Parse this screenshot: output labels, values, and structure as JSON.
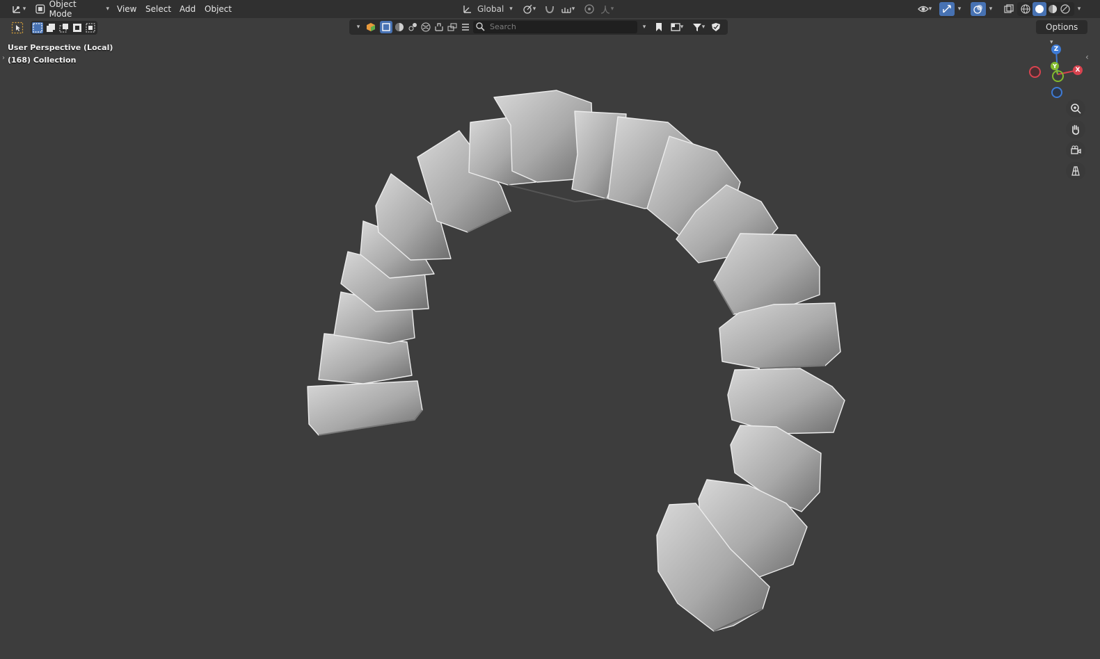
{
  "header": {
    "mode": "Object Mode",
    "menus": [
      "View",
      "Select",
      "Add",
      "Object"
    ],
    "transform_orientation": "Global"
  },
  "toolbar": {
    "search_placeholder": "Search",
    "options_label": "Options"
  },
  "viewport": {
    "perspective_label": "User Perspective (Local)",
    "collection_label": "(168) Collection"
  },
  "gizmo": {
    "z_label": "Z",
    "y_label": "Y",
    "x_label": "X",
    "x_color": "#d8434f",
    "y_color": "#82b92e",
    "z_color": "#3e7bd6"
  },
  "colors": {
    "accent": "#4772b3",
    "background": "#3d3d3d",
    "header": "#303030"
  },
  "icons": [
    "editor-type-icon",
    "object-mode-icon",
    "transform-orientation-icon",
    "pivot-icon",
    "snap-icon",
    "proportional-edit-icon",
    "visibility-icon",
    "gizmo-icon",
    "overlay-icon",
    "xray-icon",
    "shading-wireframe-icon",
    "shading-solid-icon",
    "shading-material-icon",
    "shading-rendered-icon",
    "zoom-icon",
    "pan-hand-icon",
    "camera-icon",
    "grid-icon"
  ]
}
